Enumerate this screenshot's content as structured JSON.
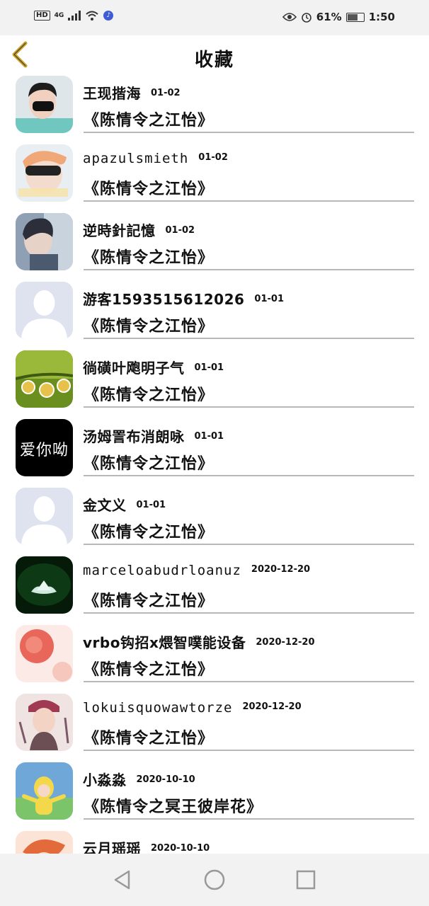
{
  "status_bar": {
    "hd": "HD",
    "network": "4G",
    "battery": "61%",
    "time": "1:50"
  },
  "header": {
    "title": "收藏"
  },
  "items": [
    {
      "name": "王现揩海",
      "date": "01-02",
      "title": "《陈情令之江怡》"
    },
    {
      "name": "apazulsmieth",
      "date": "01-02",
      "title": "《陈情令之江怡》"
    },
    {
      "name": "逆時針記憶",
      "date": "01-02",
      "title": "《陈情令之江怡》"
    },
    {
      "name": "游客1593515612026",
      "date": "01-01",
      "title": "《陈情令之江怡》"
    },
    {
      "name": "徜磺叶飑明子气",
      "date": "01-01",
      "title": "《陈情令之江怡》"
    },
    {
      "name": "汤姆詈布消朗咏",
      "date": "01-01",
      "title": "《陈情令之江怡》"
    },
    {
      "name": "金文义",
      "date": "01-01",
      "title": "《陈情令之江怡》"
    },
    {
      "name": "marceloabudrloanuz",
      "date": "2020-12-20",
      "title": "《陈情令之江怡》"
    },
    {
      "name": "vrbo钩招x煨智噗能设备",
      "date": "2020-12-20",
      "title": "《陈情令之江怡》"
    },
    {
      "name": "lokuisquowawtorze",
      "date": "2020-12-20",
      "title": "《陈情令之江怡》"
    },
    {
      "name": "小淼淼",
      "date": "2020-10-10",
      "title": "《陈情令之冥王彼岸花》"
    },
    {
      "name": "云月瑶瑶",
      "date": "2020-10-10",
      "title": ""
    }
  ],
  "avatars": {
    "item_6_text": "爱你呦"
  },
  "colors": {
    "accent": "#c9a227",
    "divider": "#b8b8b8",
    "default_avatar": "#dfe3ef"
  }
}
